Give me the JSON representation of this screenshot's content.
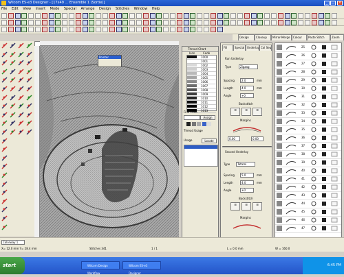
{
  "window": {
    "title": "Wilcom ES-e3 Designer - [17x49 ... Ensemble 1 (Sortie)]"
  },
  "menu": [
    "File",
    "Edit",
    "View",
    "Insert",
    "Mode",
    "Special",
    "Arrange",
    "Design",
    "Stitches",
    "Window",
    "Help"
  ],
  "tabs": [
    "Design",
    "Closeup",
    "Mirror-Merge",
    "Colour",
    "Paste Stitch",
    "Zoom"
  ],
  "mini_window": {
    "title": "Pointer"
  },
  "thread_panel": {
    "title": "Thread Chart",
    "headers": [
      "Icon",
      "Code"
    ],
    "rows": [
      {
        "color": "#111111",
        "code": "1000"
      },
      {
        "color": "#ffffff",
        "code": "1001"
      },
      {
        "color": "#d9d9d9",
        "code": "1002"
      },
      {
        "color": "#cfcfcf",
        "code": "1003"
      },
      {
        "color": "#b9b9b9",
        "code": "1004"
      },
      {
        "color": "#a5a5a5",
        "code": "1005"
      },
      {
        "color": "#8c8c8c",
        "code": "1006"
      },
      {
        "color": "#6f6f6f",
        "code": "1007"
      },
      {
        "color": "#555555",
        "code": "1008"
      },
      {
        "color": "#3f3f3f",
        "code": "1009"
      },
      {
        "color": "#262626",
        "code": "1010"
      },
      {
        "color": "#111111",
        "code": "1011"
      },
      {
        "color": "#000000",
        "code": "1012"
      },
      {
        "color": "#000000",
        "code": "1013"
      }
    ],
    "find_label": "Find Code",
    "assign_label": "Assign",
    "thread_usage_label": "Thread Usage",
    "usage_label": "Usage",
    "locate_label": "Locate"
  },
  "props": {
    "tabs": [
      "Fill",
      "Special",
      "Underlay",
      "Col Seq"
    ],
    "run_label": "Run Underlay",
    "type_label": "Type",
    "type_value": "Zigzag",
    "spacing_label": "Spacing",
    "spacing_value": "2.0",
    "length_label": "Length",
    "length_value": "4.0",
    "angle_label": "Angle",
    "angle_value": "+0",
    "unit": "mm",
    "backstitch_label": "Backstitch",
    "margin_label": "Margins",
    "margin_a": "0.00",
    "margin_b": "0.00",
    "second_label": "Second Underlay",
    "type2_value": "Tatami",
    "spacing2_value": "5.0",
    "length2_value": "4.0",
    "angle2_value": "+0"
  },
  "sequence": {
    "numbers": [
      "25",
      "26",
      "27",
      "28",
      "29",
      "30",
      "31",
      "32",
      "33",
      "34",
      "35",
      "36",
      "37",
      "38",
      "39",
      "40",
      "41",
      "42",
      "43",
      "44",
      "45",
      "46",
      "47"
    ]
  },
  "status": {
    "zoom": "Colorway 1",
    "coords": "X= 12.0 mm Y= 28.4 mm",
    "stitches": "Stitches 341",
    "page": "1 / 1",
    "len": "L = 0.0 mm",
    "w": "W = 160.0"
  },
  "taskbar": {
    "start": "start",
    "tasks": [
      "Wilcom Design Workflow",
      "Wilcom ES-e3 Designer"
    ],
    "time": "6:45 PM"
  }
}
